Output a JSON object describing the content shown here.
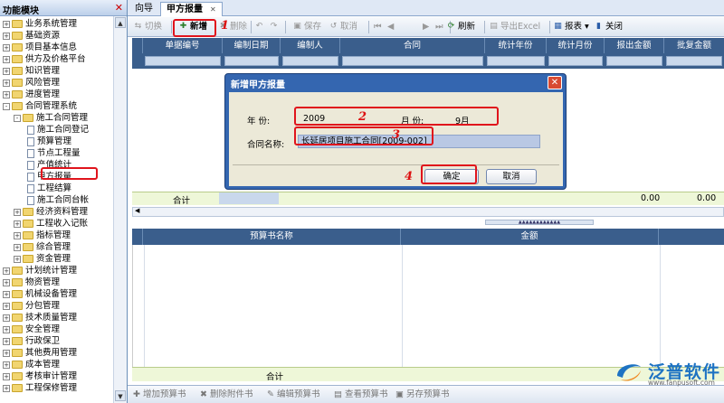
{
  "sidebar": {
    "title": "功能模块",
    "items": [
      {
        "label": "业务系统管理",
        "level": 0,
        "kind": "folder",
        "toggle": "+"
      },
      {
        "label": "基础资源",
        "level": 0,
        "kind": "folder",
        "toggle": "+"
      },
      {
        "label": "项目基本信息",
        "level": 0,
        "kind": "folder",
        "toggle": "+"
      },
      {
        "label": "供方及价格平台",
        "level": 0,
        "kind": "folder",
        "toggle": "+"
      },
      {
        "label": "知识管理",
        "level": 0,
        "kind": "folder",
        "toggle": "+"
      },
      {
        "label": "风险管理",
        "level": 0,
        "kind": "folder",
        "toggle": "+"
      },
      {
        "label": "进度管理",
        "level": 0,
        "kind": "folder",
        "toggle": "+"
      },
      {
        "label": "合同管理系统",
        "level": 0,
        "kind": "folder",
        "toggle": "-"
      },
      {
        "label": "施工合同管理",
        "level": 1,
        "kind": "folder",
        "toggle": "-"
      },
      {
        "label": "施工合同登记",
        "level": 2,
        "kind": "page",
        "toggle": ""
      },
      {
        "label": "预算管理",
        "level": 2,
        "kind": "page",
        "toggle": ""
      },
      {
        "label": "节点工程量",
        "level": 2,
        "kind": "page",
        "toggle": ""
      },
      {
        "label": "产值统计",
        "level": 2,
        "kind": "page",
        "toggle": ""
      },
      {
        "label": "甲方报量",
        "level": 2,
        "kind": "page",
        "toggle": "",
        "selected": true
      },
      {
        "label": "工程结算",
        "level": 2,
        "kind": "page",
        "toggle": ""
      },
      {
        "label": "施工合同台帐",
        "level": 2,
        "kind": "page",
        "toggle": ""
      },
      {
        "label": "经济资料管理",
        "level": 1,
        "kind": "folder",
        "toggle": "+"
      },
      {
        "label": "工程收入记账",
        "level": 1,
        "kind": "folder",
        "toggle": "+"
      },
      {
        "label": "指标管理",
        "level": 1,
        "kind": "folder",
        "toggle": "+"
      },
      {
        "label": "综合管理",
        "level": 1,
        "kind": "folder",
        "toggle": "+"
      },
      {
        "label": "资金管理",
        "level": 1,
        "kind": "folder",
        "toggle": "+"
      },
      {
        "label": "计划统计管理",
        "level": 0,
        "kind": "folder",
        "toggle": "+"
      },
      {
        "label": "物资管理",
        "level": 0,
        "kind": "folder",
        "toggle": "+"
      },
      {
        "label": "机械设备管理",
        "level": 0,
        "kind": "folder",
        "toggle": "+"
      },
      {
        "label": "分包管理",
        "level": 0,
        "kind": "folder",
        "toggle": "+"
      },
      {
        "label": "技术质量管理",
        "level": 0,
        "kind": "folder",
        "toggle": "+"
      },
      {
        "label": "安全管理",
        "level": 0,
        "kind": "folder",
        "toggle": "+"
      },
      {
        "label": "行政保卫",
        "level": 0,
        "kind": "folder",
        "toggle": "+"
      },
      {
        "label": "其他费用管理",
        "level": 0,
        "kind": "folder",
        "toggle": "+"
      },
      {
        "label": "成本管理",
        "level": 0,
        "kind": "folder",
        "toggle": "+"
      },
      {
        "label": "考核审计管理",
        "level": 0,
        "kind": "folder",
        "toggle": "+"
      },
      {
        "label": "工程保修管理",
        "level": 0,
        "kind": "folder",
        "toggle": "+"
      }
    ]
  },
  "tabs": [
    {
      "label": "向导",
      "active": false
    },
    {
      "label": "甲方报量",
      "active": true
    }
  ],
  "toolbar": {
    "switch": "切换",
    "add": "新增",
    "delete": "删除",
    "save": "保存",
    "cancel": "取消",
    "refresh": "刷新",
    "export": "导出Excel",
    "report": "报表",
    "close": "关闭"
  },
  "grid": {
    "columns": [
      "单据编号",
      "编制日期",
      "编制人",
      "合同",
      "统计年份",
      "统计月份",
      "报出金额",
      "批复金额"
    ],
    "sum_label": "合计",
    "sum_values": [
      "0.00",
      "0.00"
    ]
  },
  "grid2": {
    "columns": [
      "预算书名称",
      "金额"
    ],
    "sum_label": "合计"
  },
  "bottom_toolbar": {
    "add_budget": "增加预算书",
    "delete_attach": "删除附件书",
    "edit_budget": "编辑预算书",
    "view_budget": "查看预算书",
    "save_as": "另存预算书"
  },
  "dialog": {
    "title": "新增甲方报量",
    "year_label": "年    份:",
    "year_value": "2009",
    "month_label": "月    份:",
    "month_value": "9月",
    "contract_label": "合同名称:",
    "contract_value": "长延居项目施工合同[2009-002]",
    "ok": "确定",
    "cancel": "取消"
  },
  "annotations": [
    "1",
    "2",
    "3",
    "4"
  ],
  "logo": {
    "name": "泛普软件",
    "url": "www.fanpusoft.com"
  },
  "colors": {
    "header": "#3a5e8c",
    "dialog": "#3466b0",
    "highlight": "#e0141c",
    "sum_row": "#eef7d8"
  }
}
